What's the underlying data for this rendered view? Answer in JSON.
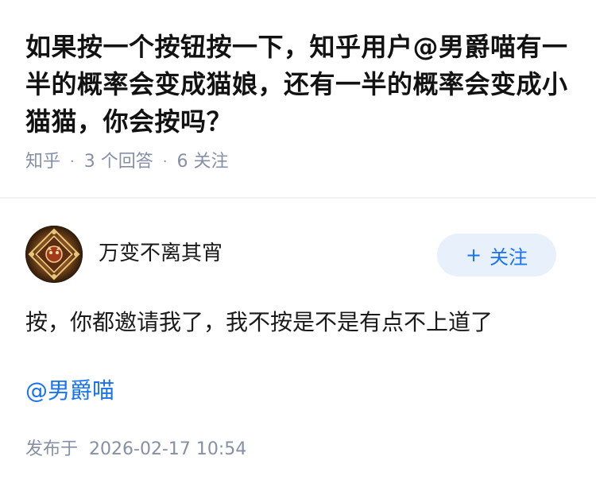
{
  "question": {
    "title": "如果按一个按钮按一下，知乎用户@男爵喵有一半的概率会变成猫娘，还有一半的概率会变成小猫猫，你会按吗？",
    "source": "知乎",
    "answers_count": "3 个回答",
    "follow_count": "6 关注"
  },
  "answer": {
    "author": {
      "name": "万变不离其宵",
      "avatar_icon": "ornate-cat-avatar"
    },
    "follow_button": {
      "plus": "+",
      "label": "关注"
    },
    "content": "按，你都邀请我了，我不按是不是有点不上道了",
    "mention": "@男爵喵",
    "publish_label": "发布于",
    "publish_time": "2026-02-17 10:54"
  },
  "colors": {
    "accent": "#1772f6",
    "meta_gray": "#8590a6",
    "follow_bg": "#e8f0fb"
  }
}
